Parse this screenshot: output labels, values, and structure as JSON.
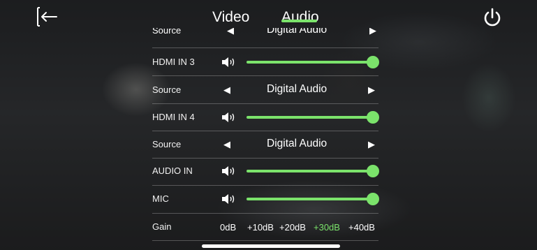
{
  "tabs": [
    {
      "label": "Video"
    },
    {
      "label": "Audio"
    }
  ],
  "active_tab": "Audio",
  "accent_color": "#7be36b",
  "icons": {
    "back": "back-exit-icon",
    "power": "power-icon",
    "speaker": "speaker-icon"
  },
  "rows": {
    "source_top": {
      "label": "Source",
      "value": "Digital Audio"
    },
    "hdmi3": {
      "label": "HDMI IN 3",
      "level": 1.0
    },
    "source_hdmi3": {
      "label": "Source",
      "value": "Digital Audio"
    },
    "hdmi4": {
      "label": "HDMI IN 4",
      "level": 1.0
    },
    "source_hdmi4": {
      "label": "Source",
      "value": "Digital Audio"
    },
    "audio_in": {
      "label": "AUDIO IN",
      "level": 1.0
    },
    "mic": {
      "label": "MIC",
      "level": 1.0
    },
    "gain": {
      "label": "Gain",
      "options": [
        "0dB",
        "+10dB",
        "+20dB",
        "+30dB",
        "+40dB"
      ],
      "selected": "+30dB"
    }
  }
}
